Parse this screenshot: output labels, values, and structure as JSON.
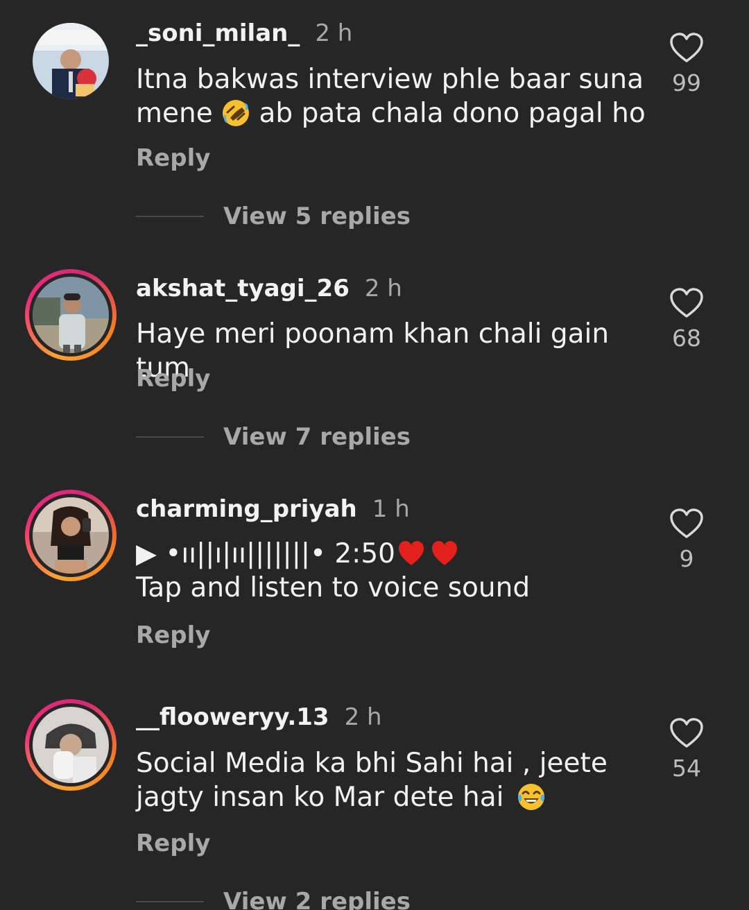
{
  "comments": [
    {
      "username": "_soni_milan_",
      "time": "2 h",
      "text_line1": "Itna bakwas interview phle baar suna",
      "text_line2_a": "mene",
      "text_line2_b": "ab pata chala dono pagal ho",
      "emoji": "rolling-on-floor-laughing",
      "reply": "Reply",
      "likes": "99",
      "view_replies": "View 5 replies",
      "has_story_ring": false
    },
    {
      "username": "akshat_tyagi_26",
      "time": "2 h",
      "text_line1": "Haye meri poonam khan chali gain tum",
      "reply": "Reply",
      "likes": "68",
      "view_replies": "View 7 replies",
      "has_story_ring": true
    },
    {
      "username": "charming_priyah",
      "time": "1 h",
      "voice_line": "▶ •ıı||ı|ıı|||||||• 2:50",
      "text_line2": "Tap and listen to voice sound",
      "emoji": "red-heart",
      "reply": "Reply",
      "likes": "9",
      "has_story_ring": true
    },
    {
      "username": "__flooweryy.13",
      "time": "2 h",
      "text_line1": "Social Media ka bhi Sahi hai , jeete",
      "text_line2_a": "jagty insan ko Mar dete hai",
      "emoji": "face-with-tears-of-joy",
      "reply": "Reply",
      "likes": "54",
      "view_replies": "View 2 replies",
      "has_story_ring": true
    }
  ],
  "colors": {
    "background": "#262626",
    "primary_text": "#f2f2f2",
    "secondary_text": "#a8a8a8",
    "story_ring_start": "#f9a334",
    "story_ring_end": "#d62976"
  }
}
